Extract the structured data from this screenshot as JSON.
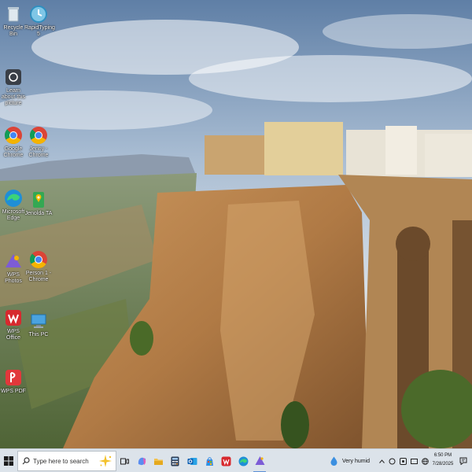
{
  "desktop": {
    "icons": [
      {
        "id": "recycle-bin",
        "label": "Recycle Bin",
        "icon": "recycle-bin-icon"
      },
      {
        "id": "rapidtyping",
        "label": "RapidTyping 5",
        "icon": "rapidtyping-icon"
      },
      {
        "id": "learn-about",
        "label": "Learn about this picture",
        "icon": "camera-icon"
      },
      {
        "id": "google-chrome",
        "label": "Google Chrome",
        "icon": "chrome-icon"
      },
      {
        "id": "jenny-chrome",
        "label": "Jenny - Chrome",
        "icon": "chrome-icon"
      },
      {
        "id": "microsoft-edge",
        "label": "Microsoft Edge",
        "icon": "edge-icon"
      },
      {
        "id": "jenolda-ta",
        "label": "Jenolda TA",
        "icon": "maps-icon"
      },
      {
        "id": "wps-photos",
        "label": "WPS Photos",
        "icon": "wps-photos-icon"
      },
      {
        "id": "person1-chrome",
        "label": "Person 1 - Chrome",
        "icon": "chrome-icon"
      },
      {
        "id": "wps-office",
        "label": "WPS Office",
        "icon": "wps-office-icon"
      },
      {
        "id": "this-pc",
        "label": "This PC",
        "icon": "computer-icon"
      },
      {
        "id": "wps-pdf",
        "label": "WPS PDF",
        "icon": "wps-pdf-icon"
      }
    ]
  },
  "taskbar": {
    "start_icon": "windows-logo-icon",
    "search": {
      "placeholder": "Type here to search",
      "icon": "search-icon"
    },
    "pinned": [
      "task-view-icon",
      "copilot-icon",
      "file-explorer-icon",
      "calculator-icon",
      "outlook-icon",
      "store-icon",
      "wps-office-icon",
      "edge-icon",
      "wps-photos-icon"
    ],
    "weather": {
      "text": "Very humid",
      "icon": "raindrop-icon"
    },
    "clock": {
      "time": "6:50 PM",
      "date": "7/28/2025"
    },
    "colors": {
      "bar": "#dce3ea",
      "wps_red": "#d7292e",
      "chrome_red": "#db4437",
      "chrome_green": "#0f9d58",
      "chrome_yellow": "#f4b400",
      "chrome_blue": "#4285f4"
    }
  }
}
